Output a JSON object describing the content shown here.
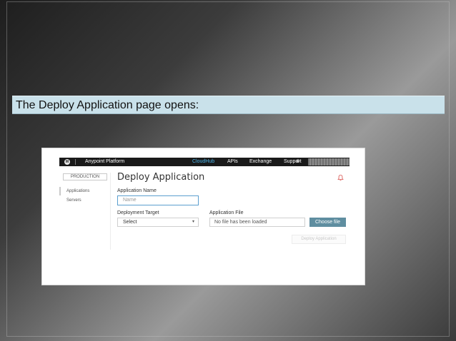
{
  "caption": "The Deploy Application page opens:",
  "screenshot": {
    "topnav": {
      "brand": "Anypoint Platform",
      "items": [
        "CloudHub",
        "APIs",
        "Exchange",
        "Support"
      ],
      "active_item": "CloudHub",
      "logo_icon": "mulesoft-logo-icon",
      "settings_icon": "gear-icon"
    },
    "environment_button": "PRODUCTION",
    "sidebar": {
      "items": [
        "Applications",
        "Servers"
      ],
      "active": "Applications"
    },
    "page_title": "Deploy Application",
    "form": {
      "app_name_label": "Application Name",
      "app_name_placeholder": "Name",
      "deployment_target_label": "Deployment Target",
      "deployment_target_value": "Select",
      "app_file_label": "Application File",
      "app_file_value": "No file has been loaded",
      "choose_file_button": "Choose file",
      "deploy_button": "Deploy Application"
    },
    "colors": {
      "caption_bg": "#c9e1ea",
      "nav_bg": "#1a1a1a",
      "active_nav": "#4ab3e8",
      "bell": "#d9534f",
      "choose_button_bg": "#5f8ea0"
    }
  }
}
